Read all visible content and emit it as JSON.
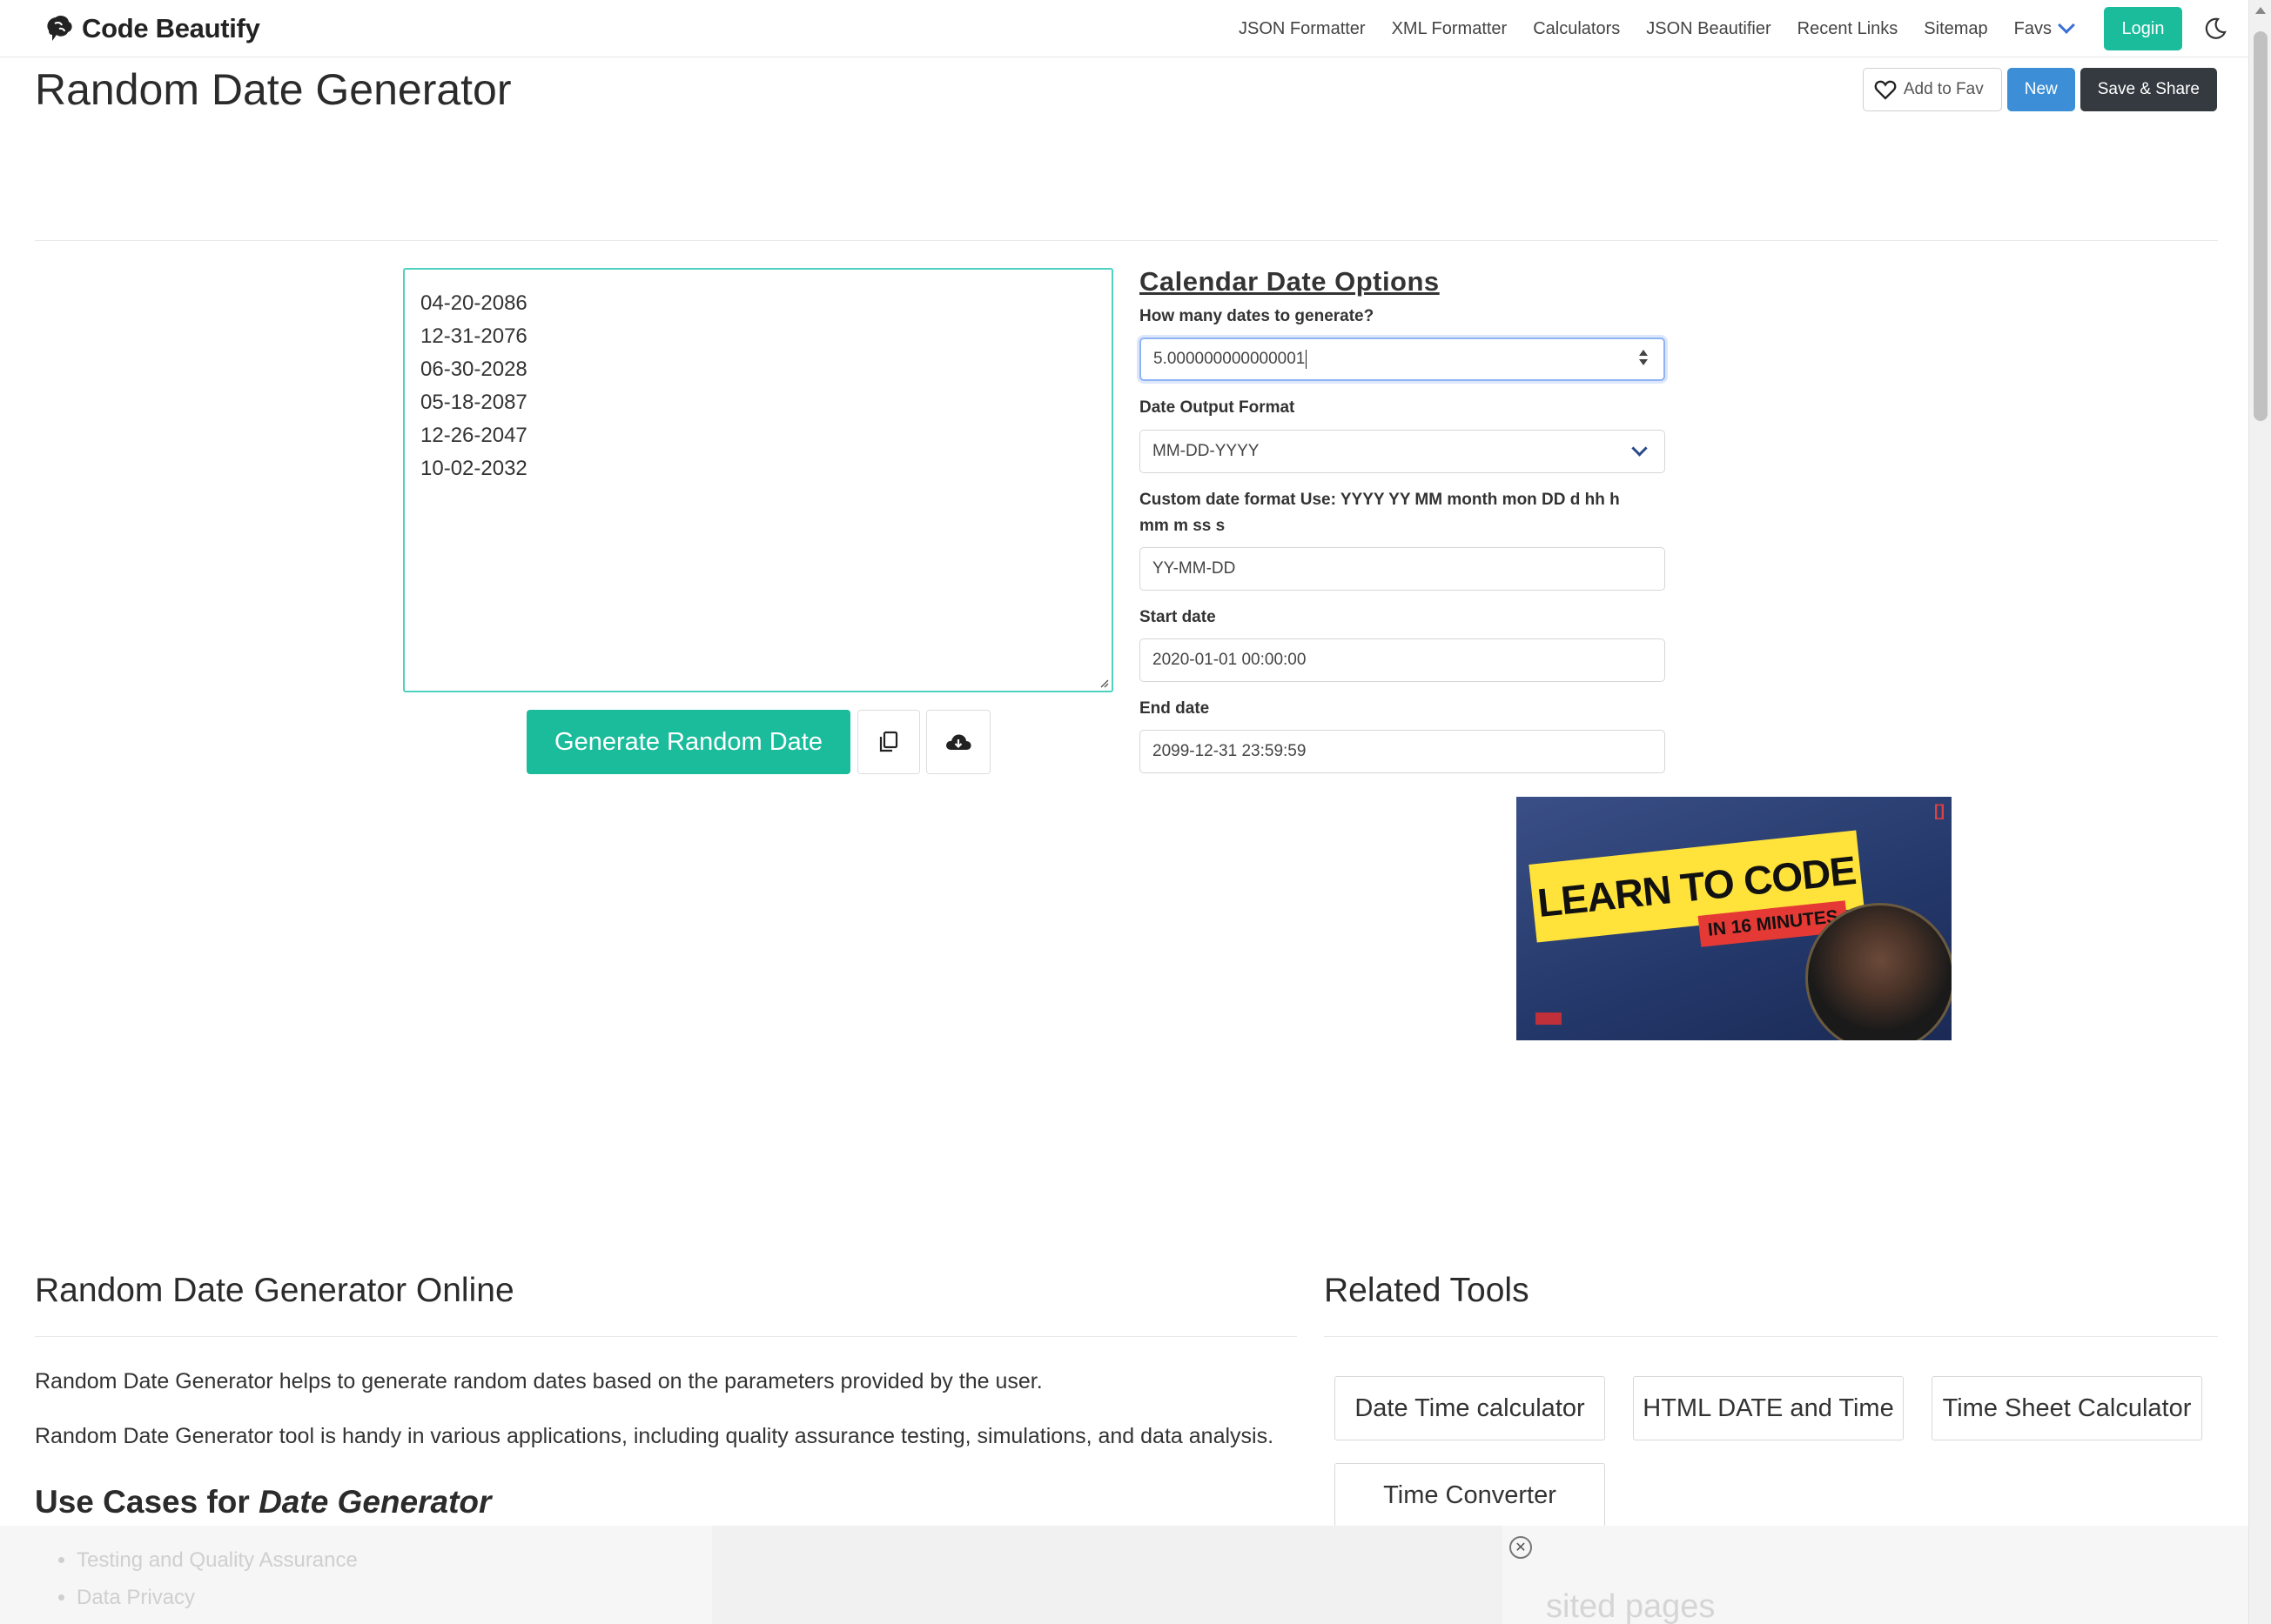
{
  "brand": {
    "name": "Code Beautify"
  },
  "nav": {
    "links": [
      "JSON Formatter",
      "XML Formatter",
      "Calculators",
      "JSON Beautifier",
      "Recent Links",
      "Sitemap"
    ],
    "favs_label": "Favs",
    "login_label": "Login"
  },
  "page": {
    "title": "Random Date Generator",
    "add_to_fav_label": "Add to Fav",
    "new_label": "New",
    "save_share_label": "Save & Share"
  },
  "output": {
    "lines": [
      "04-20-2086",
      "12-31-2076",
      "06-30-2028",
      "05-18-2087",
      "12-26-2047",
      "10-02-2032"
    ]
  },
  "actions": {
    "generate_label": "Generate Random Date"
  },
  "options": {
    "heading": "Calendar Date Options",
    "count_label": "How many dates to generate?",
    "count_value": "5.000000000000001",
    "format_label": "Date Output Format",
    "format_value": "MM-DD-YYYY",
    "custom_label_line1": "Custom date format Use: YYYY YY MM month mon DD d hh h",
    "custom_label_line2": "mm m ss s",
    "custom_value": "YY-MM-DD",
    "start_label": "Start date",
    "start_value": "2020-01-01 00:00:00",
    "end_label": "End date",
    "end_value": "2099-12-31 23:59:59"
  },
  "video": {
    "headline": "LEARN TO CODE",
    "subline": "IN 16 MINUTES",
    "corner": "[]"
  },
  "content": {
    "online_title": "Random Date Generator Online",
    "para1": "Random Date Generator helps to generate random dates based on the parameters provided by the user.",
    "para2": "Random Date Generator tool is handy in various applications, including quality assurance testing, simulations, and data analysis.",
    "usecase_prefix": "Use Cases for ",
    "usecase_emph": "Date Generator",
    "usecases": [
      "Testing and Quality Assurance",
      "Data Privacy"
    ]
  },
  "related": {
    "title": "Related Tools",
    "tools": [
      "Date Time calculator",
      "HTML DATE and Time",
      "Time Sheet Calculator",
      "Time Converter"
    ],
    "faded_heading": "sited pages"
  },
  "colors": {
    "accent": "#1abc9c",
    "blue": "#3c8fd6",
    "dark": "#343a40",
    "focus_border": "#4fd1c1"
  },
  "icons": {
    "logo": "brain-logo-icon",
    "favs_chevron": "chevron-down-icon",
    "theme": "moon-icon",
    "fav": "heart-icon",
    "copy": "copy-icon",
    "download": "cloud-download-icon",
    "ad_close": "close-circle-icon"
  }
}
